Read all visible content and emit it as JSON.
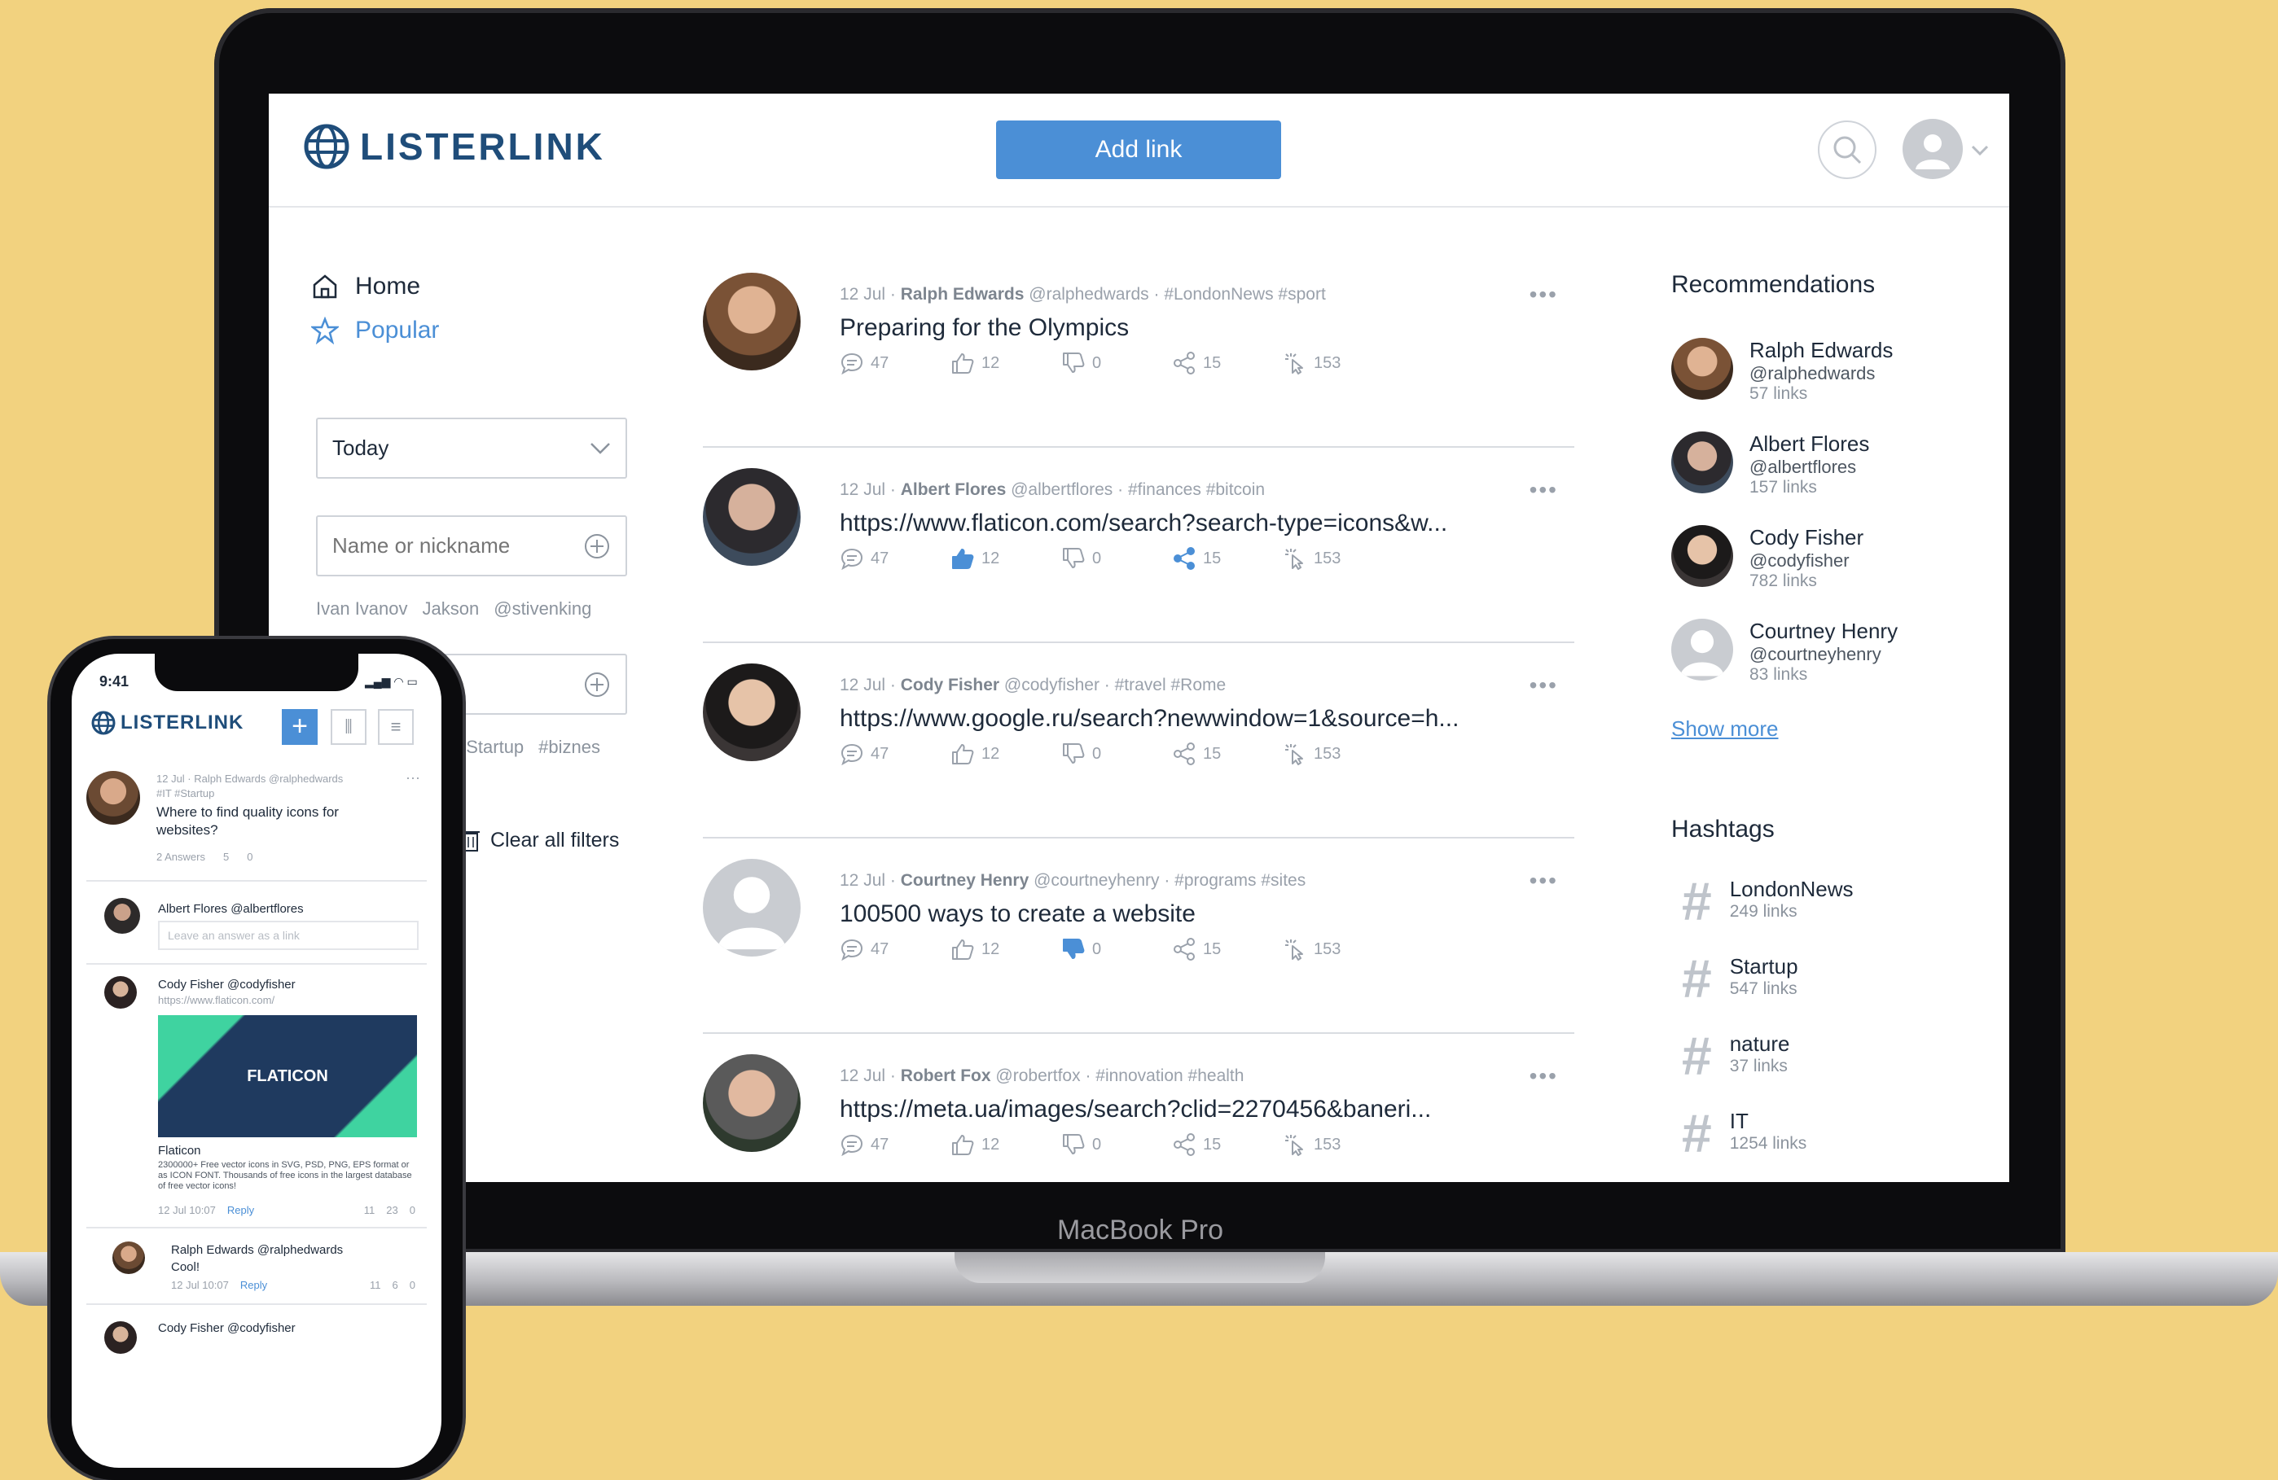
{
  "app": {
    "brand": "LISTERLINK",
    "add_link": "Add link"
  },
  "device": {
    "laptop_label": "MacBook Pro",
    "phone_time": "9:41"
  },
  "nav": {
    "home": "Home",
    "popular": "Popular"
  },
  "filters": {
    "period": "Today",
    "name_placeholder": "Name or nickname",
    "name_suggestions": [
      "Ivan Ivanov",
      "Jakson",
      "@stivenking"
    ],
    "tag_suggestions": [
      "#Startup",
      "#biznes"
    ],
    "clear_all": "Clear all filters"
  },
  "posts": [
    {
      "date": "12 Jul",
      "author": "Ralph Edwards",
      "handle": "@ralphedwards",
      "tags": "#LondonNews #sport",
      "title": "Preparing for the Olympics",
      "comments": "47",
      "likes": "12",
      "dislikes": "0",
      "shares": "15",
      "clicks": "153"
    },
    {
      "date": "12 Jul",
      "author": "Albert Flores",
      "handle": "@albertflores",
      "tags": "#finances #bitcoin",
      "title": "https://www.flaticon.com/search?search-type=icons&w...",
      "comments": "47",
      "likes": "12",
      "dislikes": "0",
      "shares": "15",
      "clicks": "153"
    },
    {
      "date": "12 Jul",
      "author": "Cody Fisher",
      "handle": "@codyfisher",
      "tags": "#travel #Rome",
      "title": "https://www.google.ru/search?newwindow=1&source=h...",
      "comments": "47",
      "likes": "12",
      "dislikes": "0",
      "shares": "15",
      "clicks": "153"
    },
    {
      "date": "12 Jul",
      "author": "Courtney Henry",
      "handle": "@courtneyhenry",
      "tags": "#programs #sites",
      "title": "100500 ways to create a website",
      "comments": "47",
      "likes": "12",
      "dislikes": "0",
      "shares": "15",
      "clicks": "153"
    },
    {
      "date": "12 Jul",
      "author": "Robert Fox",
      "handle": "@robertfox",
      "tags": "#innovation #health",
      "title": "https://meta.ua/images/search?clid=2270456&baneri...",
      "comments": "47",
      "likes": "12",
      "dislikes": "0",
      "shares": "15",
      "clicks": "153"
    }
  ],
  "recommendations": {
    "title": "Recommendations",
    "items": [
      {
        "name": "Ralph Edwards",
        "handle": "@ralphedwards",
        "links": "57 links"
      },
      {
        "name": "Albert Flores",
        "handle": "@albertflores",
        "links": "157 links"
      },
      {
        "name": "Cody Fisher",
        "handle": "@codyfisher",
        "links": "782 links"
      },
      {
        "name": "Courtney Henry",
        "handle": "@courtneyhenry",
        "links": "83 links"
      }
    ],
    "show_more": "Show more"
  },
  "hashtags": {
    "title": "Hashtags",
    "items": [
      {
        "name": "LondonNews",
        "links": "249 links"
      },
      {
        "name": "Startup",
        "links": "547 links"
      },
      {
        "name": "nature",
        "links": "37 links"
      },
      {
        "name": "IT",
        "links": "1254 links"
      }
    ]
  },
  "phone": {
    "q_meta": "12 Jul · Ralph Edwards @ralphedwards",
    "q_tags": "#IT #Startup",
    "q_title": "Where to find quality icons for websites?",
    "q_answers": "2 Answers",
    "q_likes": "5",
    "q_dislikes": "0",
    "reply_author": "Albert Flores @albertflores",
    "reply_placeholder": "Leave an answer as a link",
    "a1_author": "Cody Fisher @codyfisher",
    "a1_link": "https://www.flaticon.com/",
    "a1_banner": "FLATICON",
    "a1_site": "Flaticon",
    "a1_desc": "2300000+ Free vector icons in SVG, PSD, PNG, EPS format or as ICON FONT. Thousands of free icons in the largest database of free vector icons!",
    "a1_time": "12 Jul 10:07",
    "reply": "Reply",
    "a1_shares": "11",
    "a1_likes": "23",
    "a1_dislikes": "0",
    "a2_author": "Ralph Edwards @ralphedwards",
    "a2_text": "Cool!",
    "a2_time": "12 Jul 10:07",
    "a2_shares": "11",
    "a2_likes": "6",
    "a2_dislikes": "0",
    "a3_author": "Cody Fisher @codyfisher"
  },
  "colors": {
    "accent": "#4b8fd6",
    "brand": "#1f4d7a",
    "background": "#f2d27f"
  }
}
